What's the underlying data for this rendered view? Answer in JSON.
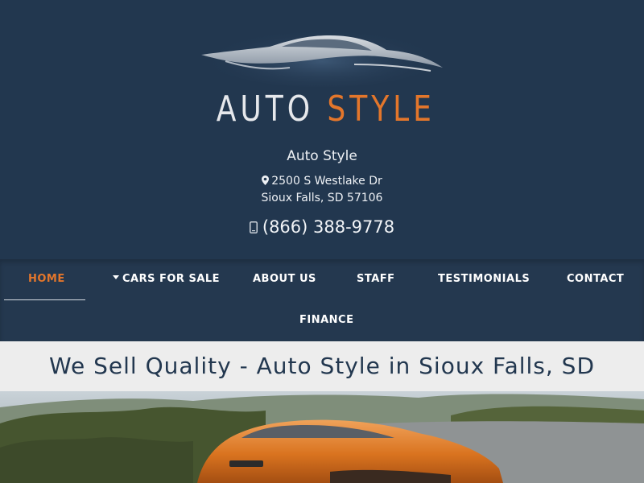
{
  "logo": {
    "word1": "AUTO",
    "word2": "STYLE"
  },
  "dealer": {
    "name": "Auto Style",
    "address_line1": "2500 S Westlake Dr",
    "address_line2": "Sioux Falls, SD 57106",
    "phone": "(866) 388-9778"
  },
  "nav": {
    "items": [
      {
        "label": "HOME",
        "active": true
      },
      {
        "label": "CARS FOR SALE",
        "has_dropdown": true
      },
      {
        "label": "ABOUT US"
      },
      {
        "label": "STAFF"
      },
      {
        "label": "TESTIMONIALS"
      },
      {
        "label": "CONTACT"
      },
      {
        "label": "FINANCE"
      }
    ]
  },
  "banner": {
    "heading": "We Sell Quality - Auto Style in Sioux Falls, SD"
  },
  "colors": {
    "header_bg": "#22374f",
    "accent": "#e3762b",
    "banner_bg": "#ededed"
  },
  "icons": {
    "address": "map-marker-icon",
    "phone": "mobile-phone-icon",
    "dropdown": "caret-down-icon"
  }
}
